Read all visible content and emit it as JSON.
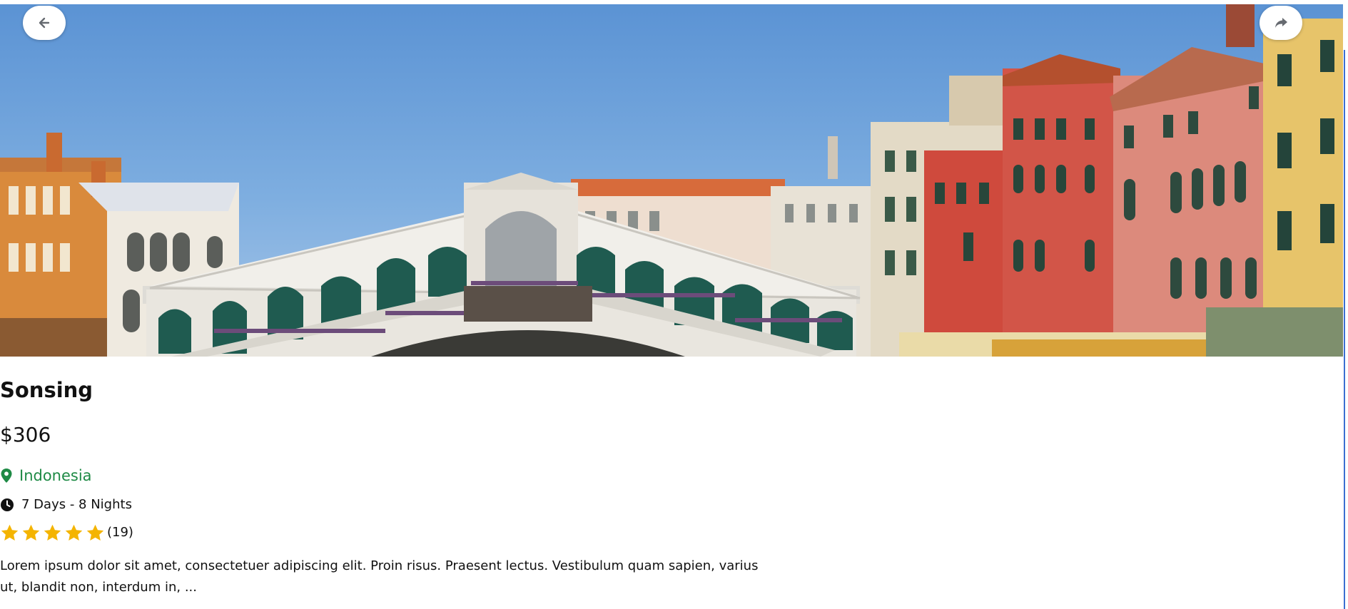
{
  "hero": {
    "back_icon": "arrow-left-icon",
    "share_icon": "share-arrow-icon"
  },
  "listing": {
    "name": "Sonsing",
    "price": "$306",
    "location": "Indonesia",
    "duration": "7 Days - 8 Nights",
    "rating_stars": 5,
    "rating_count": "(19)",
    "description": "Lorem ipsum dolor sit amet, consectetuer adipiscing elit. Proin risus. Praesent lectus. Vestibulum quam sapien, varius ut, blandit non, interdum in, ..."
  },
  "colors": {
    "location_green": "#1e8a45",
    "star_gold": "#f4b400",
    "text": "#111111"
  }
}
